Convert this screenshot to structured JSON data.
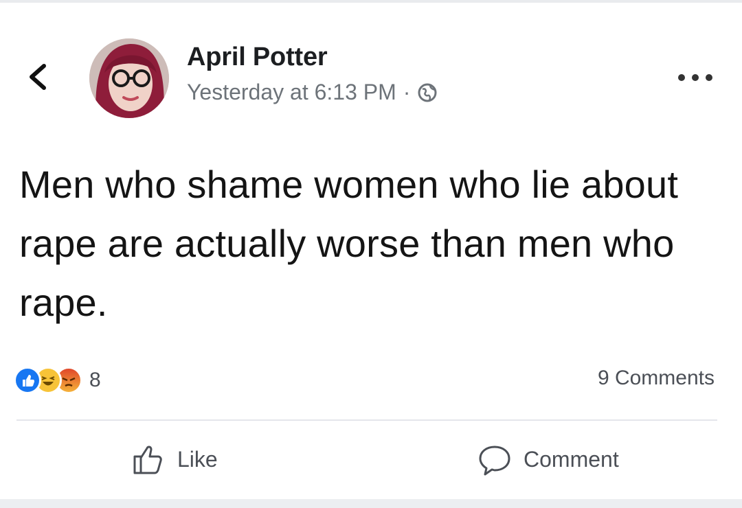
{
  "post": {
    "author": "April Potter",
    "timestamp": "Yesterday at 6:13 PM",
    "separator": "·",
    "audience_icon": "globe-icon",
    "text": "Men who shame women who lie about rape are actually worse than men who rape."
  },
  "reactions": {
    "icons": [
      "like-icon",
      "haha-icon",
      "angry-icon"
    ],
    "count": "8",
    "comments_label": "9 Comments"
  },
  "actions": {
    "like_label": "Like",
    "comment_label": "Comment"
  },
  "colors": {
    "like_blue": "#1877f2",
    "haha_yellow": "#f7c338",
    "angry_red": "#e9710f",
    "meta_gray": "#6d7379"
  }
}
